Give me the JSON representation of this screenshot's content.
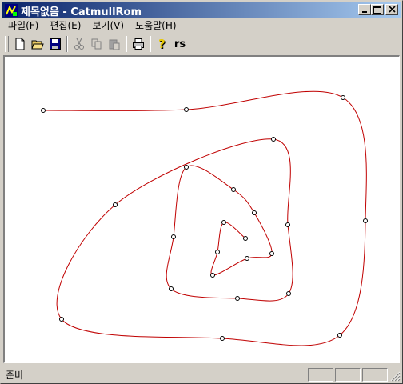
{
  "window": {
    "title": "제목없음 - CatmullRom"
  },
  "menubar": {
    "items": [
      "파일(F)",
      "편집(E)",
      "보기(V)",
      "도움말(H)"
    ]
  },
  "toolbar": {
    "text_button": "rs"
  },
  "statusbar": {
    "text": "준비"
  },
  "colors": {
    "curve": "#c00000",
    "titlebar_start": "#0a246a",
    "titlebar_end": "#a6caf0",
    "face": "#d4d0c8"
  },
  "curve": {
    "type": "catmull-rom",
    "control_points": [
      [
        48,
        67
      ],
      [
        227,
        66
      ],
      [
        423,
        51
      ],
      [
        451,
        205
      ],
      [
        419,
        348
      ],
      [
        272,
        352
      ],
      [
        71,
        328
      ],
      [
        138,
        185
      ],
      [
        336,
        103
      ],
      [
        354,
        210
      ],
      [
        355,
        296
      ],
      [
        291,
        302
      ],
      [
        208,
        290
      ],
      [
        211,
        225
      ],
      [
        227,
        138
      ],
      [
        286,
        166
      ],
      [
        312,
        195
      ],
      [
        334,
        246
      ],
      [
        303,
        252
      ],
      [
        260,
        273
      ],
      [
        266,
        244
      ],
      [
        274,
        207
      ],
      [
        301,
        227
      ]
    ]
  }
}
